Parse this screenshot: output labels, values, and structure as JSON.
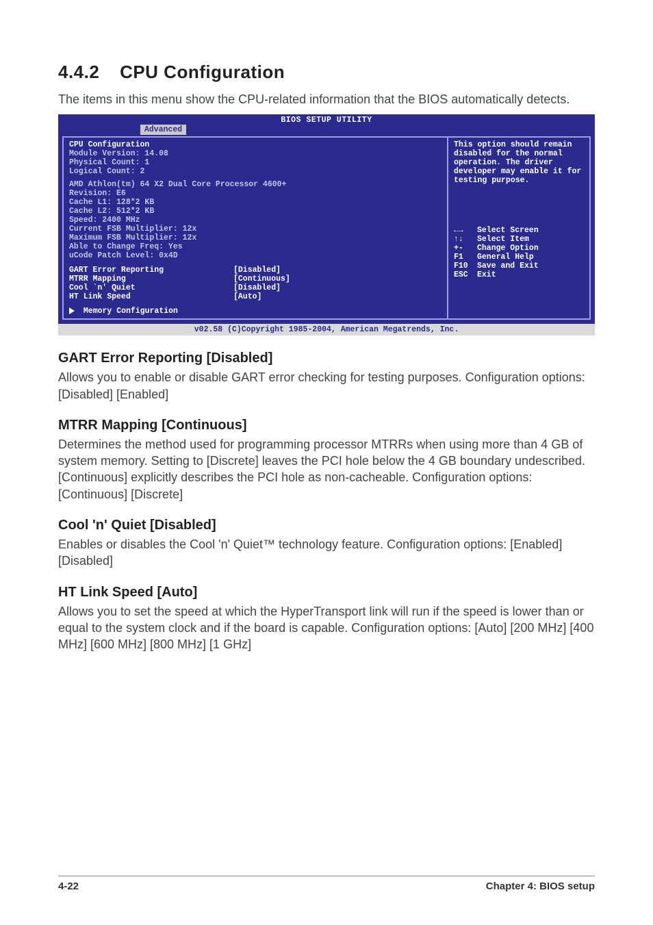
{
  "heading": {
    "number": "4.4.2",
    "title": "CPU Configuration"
  },
  "intro": "The items in this menu show the CPU-related information that the BIOS automatically detects.",
  "bios": {
    "title": "BIOS SETUP UTILITY",
    "tab": "Advanced",
    "left": {
      "cpu_conf": "CPU Configuration",
      "mod_ver": "Module Version: 14.08",
      "phys": "Physical Count: 1",
      "log": "Logical Count: 2",
      "cpu_name": "AMD Athlon(tm) 64 X2 Dual Core Processor 4600+",
      "rev": "Revision: E6",
      "l1": "Cache L1: 128*2 KB",
      "l2": "Cache L2: 512*2 KB",
      "speed": "Speed: 2400 MHz",
      "cur_fsb": "Current FSB Multiplier: 12x",
      "max_fsb": "Maximum FSB Multiplier: 12x",
      "able": "Able to Change Freq: Yes",
      "ucode": "uCode Patch Level: 0x4D",
      "opt1_lbl": "GART Error Reporting",
      "opt1_val": "[Disabled]",
      "opt2_lbl": "MTRR Mapping",
      "opt2_val": "[Continuous]",
      "opt3_lbl": "Cool `n' Quiet",
      "opt3_val": "[Disabled]",
      "opt4_lbl": "HT Link Speed",
      "opt4_val": "[Auto]",
      "submenu": "Memory Configuration"
    },
    "right": {
      "help": "This option should remain disabled for the normal operation. The driver developer may enable it for testing purpose.",
      "nav": {
        "n1_k": "←→",
        "n1_t": "Select Screen",
        "n2_k": "↑↓",
        "n2_t": "Select Item",
        "n3_k": "+-",
        "n3_t": "Change Option",
        "n4_k": "F1",
        "n4_t": "General Help",
        "n5_k": "F10",
        "n5_t": "Save and Exit",
        "n6_k": "ESC",
        "n6_t": "Exit"
      }
    },
    "footer": "v02.58 (C)Copyright 1985-2004, American Megatrends, Inc."
  },
  "options": [
    {
      "heading": "GART Error Reporting [Disabled]",
      "body": "Allows you to enable or disable GART error checking for testing purposes. Configuration options: [Disabled] [Enabled]"
    },
    {
      "heading": "MTRR Mapping [Continuous]",
      "body": "Determines the method used for programming processor MTRRs when using more than 4 GB of system memory. Setting to [Discrete] leaves the PCI hole below the 4 GB boundary undescribed. [Continuous] explicitly describes the PCI hole as non-cacheable. Configuration options: [Continuous] [Discrete]"
    },
    {
      "heading": "Cool 'n' Quiet [Disabled]",
      "body": "Enables or disables the Cool 'n' Quiet™ technology feature. Configuration options: [Enabled] [Disabled]"
    },
    {
      "heading": "HT Link Speed [Auto]",
      "body": "Allows you to set the speed at which the HyperTransport link will run if the speed is lower than or equal to the system clock and if the board is capable. Configuration options: [Auto] [200 MHz] [400 MHz] [600 MHz] [800 MHz] [1 GHz]"
    }
  ],
  "footer": {
    "page": "4-22",
    "chapter": "Chapter 4: BIOS setup"
  }
}
